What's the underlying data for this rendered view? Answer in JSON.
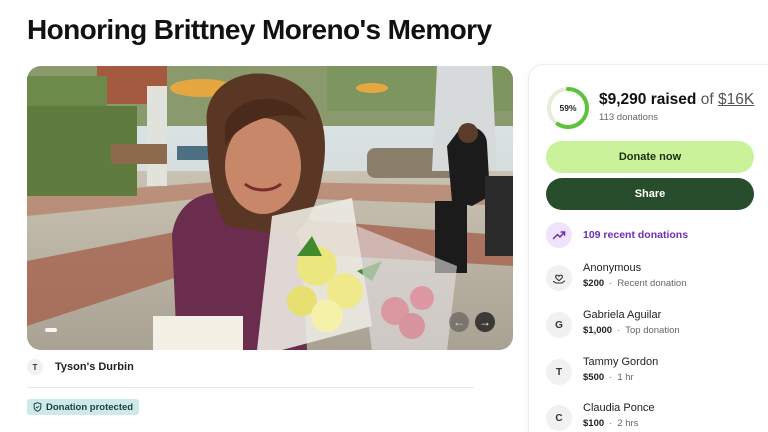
{
  "campaign": {
    "title": "Honoring Brittney Moreno's Memory"
  },
  "hero": {
    "prev_symbol": "←",
    "next_symbol": "→"
  },
  "organizer": {
    "initial": "T",
    "name": "Tyson's Durbin"
  },
  "badge": {
    "label": "Donation protected",
    "icon": "shield-icon"
  },
  "progress": {
    "percent_label": "59%",
    "fraction": 0.59,
    "raised": "$9,290 raised",
    "of": "of",
    "goal": "$16K",
    "donation_count": "113 donations"
  },
  "buttons": {
    "donate": "Donate now",
    "share": "Share"
  },
  "recent": {
    "label": "109 recent donations",
    "icon": "trending-up-icon"
  },
  "donations": [
    {
      "initial": "",
      "icon": "heart-hand-icon",
      "name": "Anonymous",
      "amount": "$200",
      "note": "Recent donation"
    },
    {
      "initial": "G",
      "name": "Gabriela Aguilar",
      "amount": "$1,000",
      "note": "Top donation"
    },
    {
      "initial": "T",
      "name": "Tammy Gordon",
      "amount": "$500",
      "note": "1 hr"
    },
    {
      "initial": "C",
      "name": "Claudia Ponce",
      "amount": "$100",
      "note": "2 hrs"
    }
  ],
  "colors": {
    "donate_bg": "#c9f29b",
    "share_bg": "#284d2c",
    "progress_ring": "#5cc43c",
    "recent_accent": "#6a2fb4",
    "badge_bg": "#cdeae8"
  }
}
